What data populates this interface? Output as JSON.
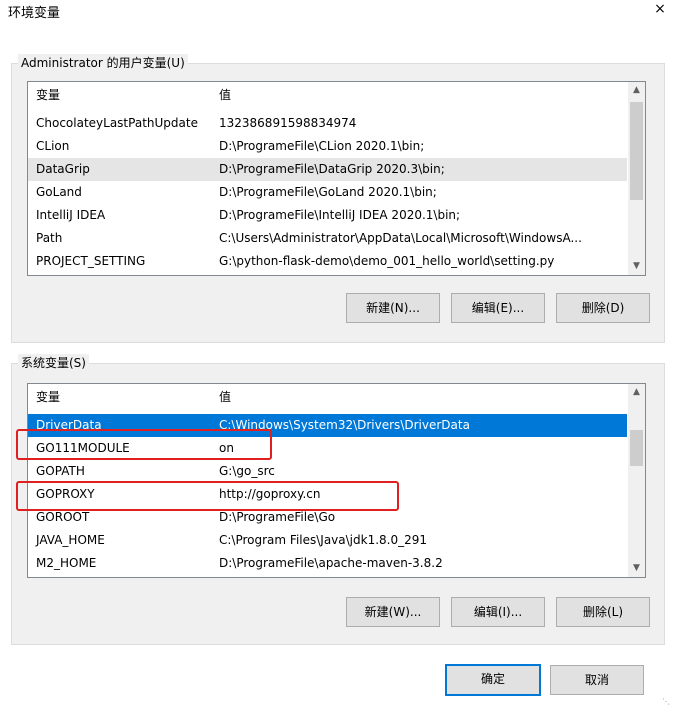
{
  "window": {
    "title": "环境变量",
    "close_icon": "×"
  },
  "user_vars": {
    "group_label": "Administrator 的用户变量(U)",
    "col_name": "变量",
    "col_value": "值",
    "rows": [
      {
        "name": "ChocolateyLastPathUpdate",
        "value": "132386891598834974"
      },
      {
        "name": "CLion",
        "value": "D:\\ProgrameFile\\CLion 2020.1\\bin;"
      },
      {
        "name": "DataGrip",
        "value": "D:\\ProgrameFile\\DataGrip 2020.3\\bin;"
      },
      {
        "name": "GoLand",
        "value": "D:\\ProgrameFile\\GoLand 2020.1\\bin;"
      },
      {
        "name": "IntelliJ IDEA",
        "value": "D:\\ProgrameFile\\IntelliJ IDEA 2020.1\\bin;"
      },
      {
        "name": "Path",
        "value": "C:\\Users\\Administrator\\AppData\\Local\\Microsoft\\WindowsA..."
      },
      {
        "name": "PROJECT_SETTING",
        "value": "G:\\python-flask-demo\\demo_001_hello_world\\setting.py"
      }
    ],
    "buttons": {
      "new": "新建(N)...",
      "edit": "编辑(E)...",
      "delete": "删除(D)"
    }
  },
  "system_vars": {
    "group_label": "系统变量(S)",
    "col_name": "变量",
    "col_value": "值",
    "rows": [
      {
        "name": "DriverData",
        "value": "C:\\Windows\\System32\\Drivers\\DriverData"
      },
      {
        "name": "GO111MODULE",
        "value": "on"
      },
      {
        "name": "GOPATH",
        "value": "G:\\go_src"
      },
      {
        "name": "GOPROXY",
        "value": "http://goproxy.cn"
      },
      {
        "name": "GOROOT",
        "value": "D:\\ProgrameFile\\Go"
      },
      {
        "name": "JAVA_HOME",
        "value": "C:\\Program Files\\Java\\jdk1.8.0_291"
      },
      {
        "name": "M2_HOME",
        "value": "D:\\ProgrameFile\\apache-maven-3.8.2"
      }
    ],
    "buttons": {
      "new": "新建(W)...",
      "edit": "编辑(I)...",
      "delete": "删除(L)"
    }
  },
  "footer": {
    "ok": "确定",
    "cancel": "取消"
  },
  "colors": {
    "selection": "#0078d7",
    "highlight_box": "#e02020"
  }
}
